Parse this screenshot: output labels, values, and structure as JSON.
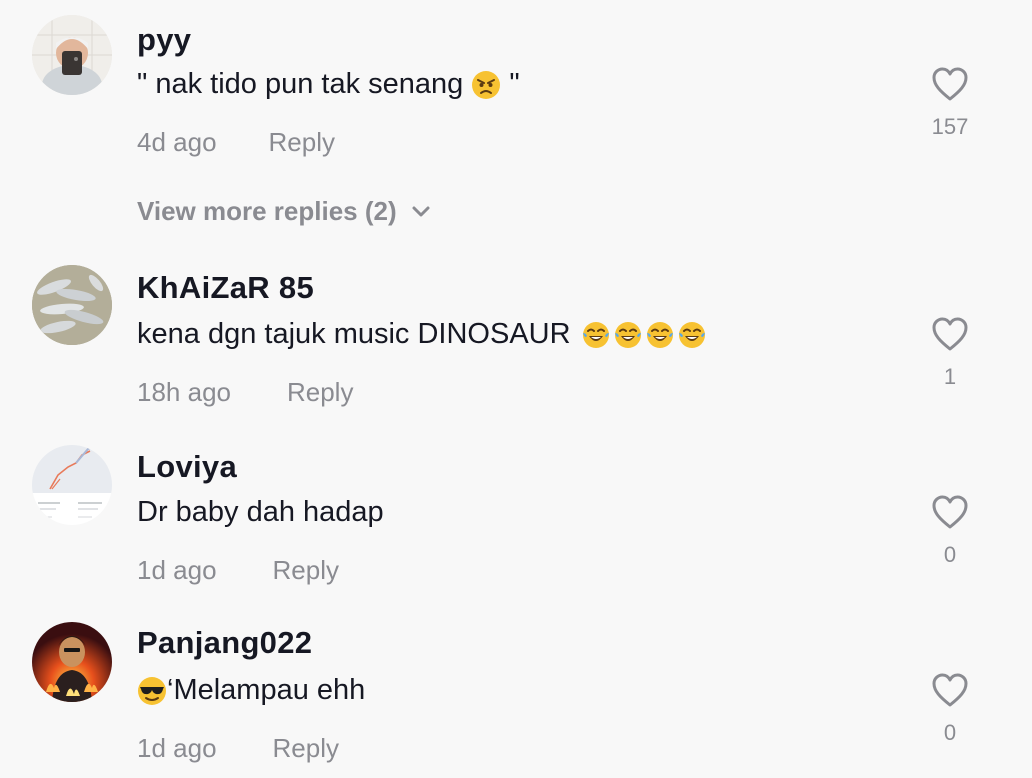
{
  "comments": [
    {
      "username": "pyy",
      "text_before": "\" nak tido pun tak senang ",
      "text_after": " \"",
      "emoji": [
        "angry-face"
      ],
      "time": "4d ago",
      "reply_label": "Reply",
      "likes": "157",
      "view_more": "View more replies (2)"
    },
    {
      "username": "KhAiZaR 85",
      "text_before": "kena dgn tajuk music DINOSAUR ",
      "text_after": "",
      "emoji": [
        "tears-of-joy",
        "tears-of-joy",
        "tears-of-joy",
        "tears-of-joy"
      ],
      "time": "18h ago",
      "reply_label": "Reply",
      "likes": "1"
    },
    {
      "username": "Loviya",
      "text_before": "Dr baby dah hadap",
      "text_after": "",
      "emoji": [],
      "time": "1d ago",
      "reply_label": "Reply",
      "likes": "0"
    },
    {
      "username": "Panjang022",
      "text_before": "",
      "text_after": "‘Melampau ehh",
      "emoji": [
        "sunglasses-face"
      ],
      "time": "1d ago",
      "reply_label": "Reply",
      "likes": "0"
    }
  ],
  "colors": {
    "background": "#f8f8f8",
    "primary_text": "#161823",
    "secondary_text": "#8a8b91",
    "heart_outline": "#8a8b91"
  },
  "icons": {
    "like": "heart-outline-icon",
    "expand": "chevron-down-icon"
  }
}
